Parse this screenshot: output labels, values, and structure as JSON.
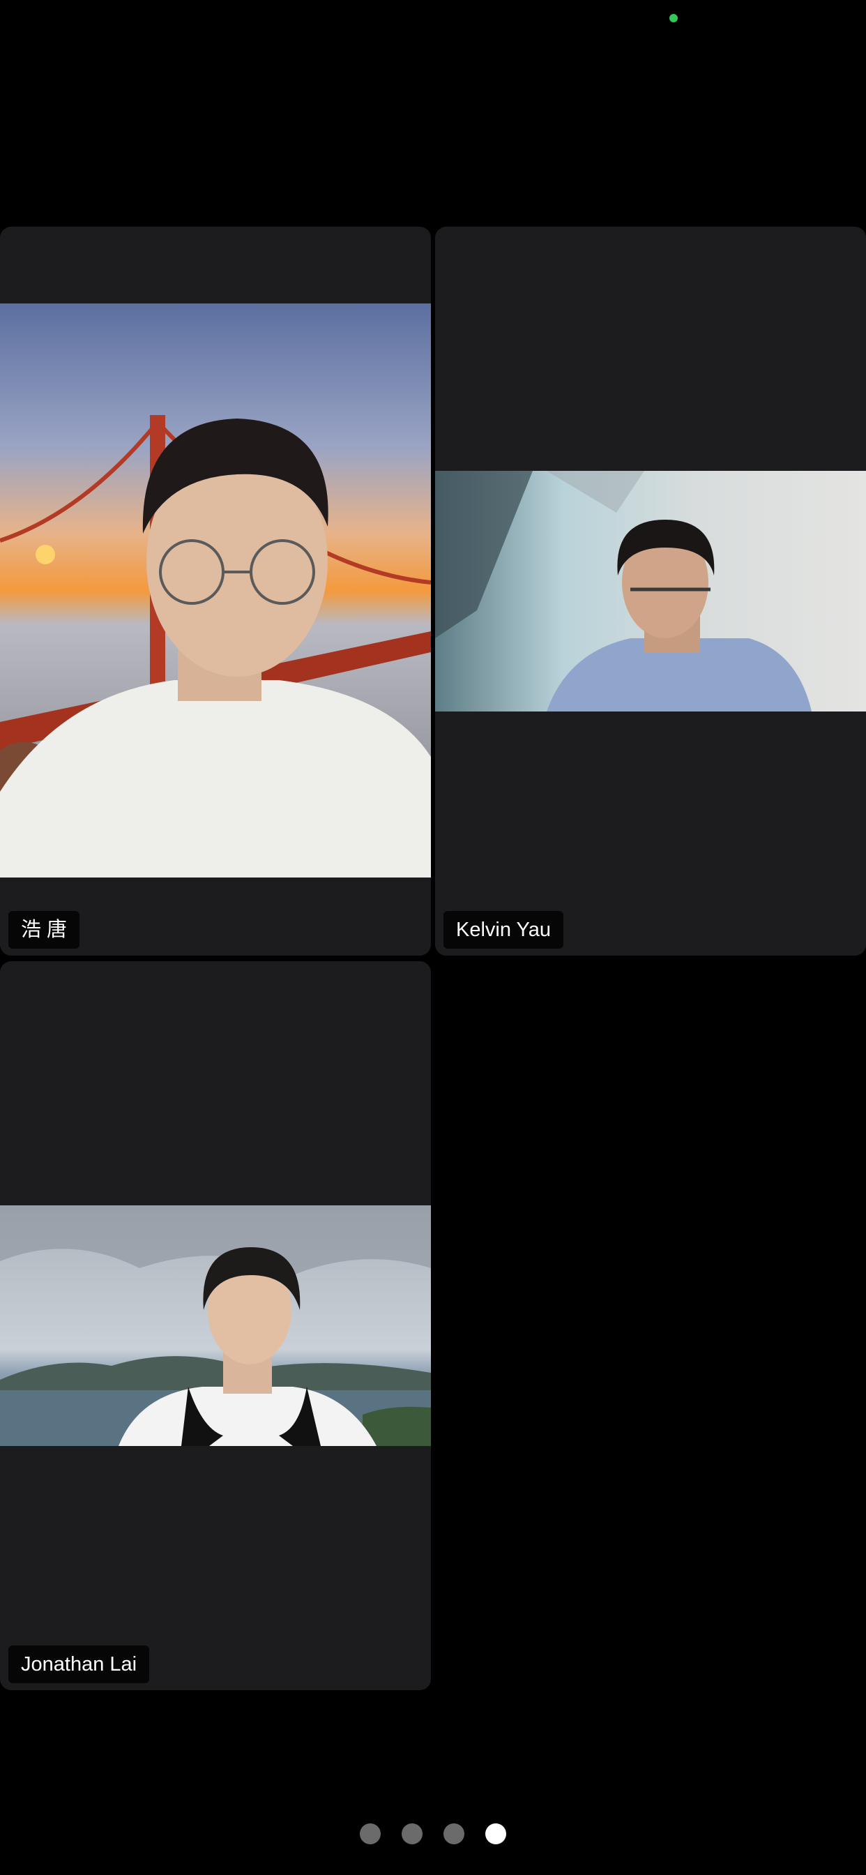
{
  "participants": [
    {
      "name": "浩 唐"
    },
    {
      "name": "Kelvin Yau"
    },
    {
      "name": "Jonathan Lai"
    }
  ],
  "pager": {
    "total": 4,
    "active": 4
  },
  "colors": {
    "background": "#000000",
    "tile": "#1c1c1e",
    "recording_dot": "#34c759",
    "page_dot": "#6b6b6b",
    "page_dot_active": "#ffffff"
  }
}
